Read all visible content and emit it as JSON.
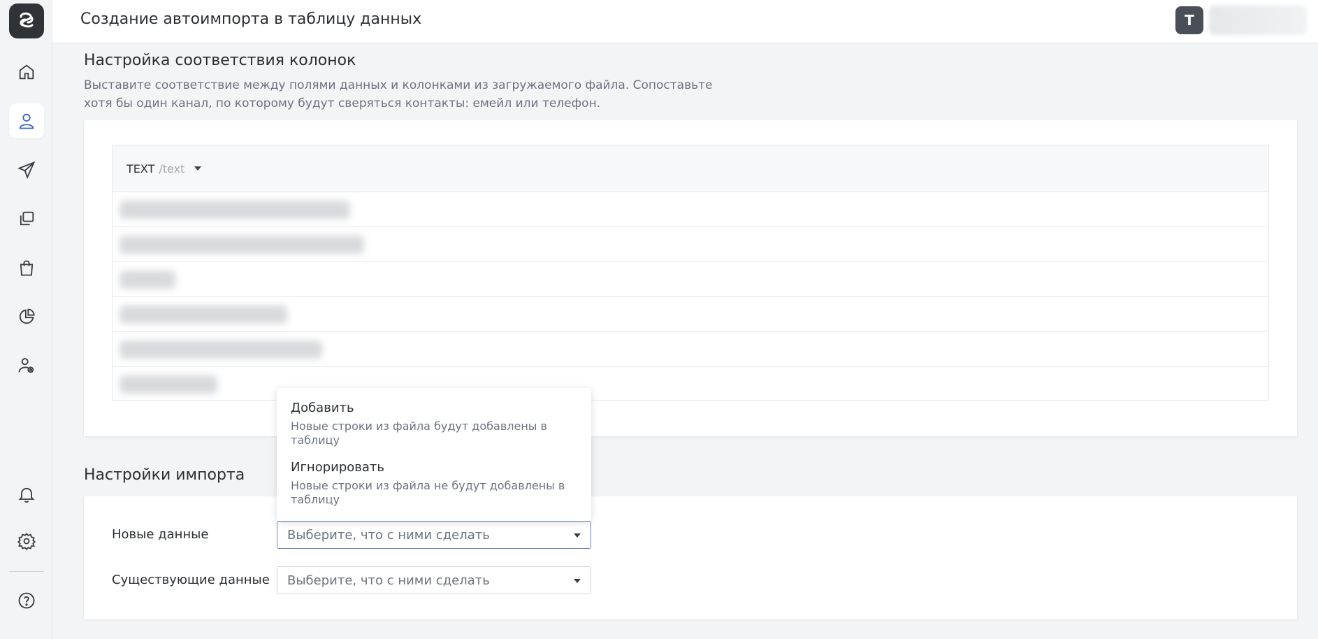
{
  "header": {
    "title": "Создание автоимпорта в таблицу данных",
    "avatar_letter": "T"
  },
  "sidebar": {
    "items": [
      {
        "name": "home-icon",
        "active": false
      },
      {
        "name": "user-icon",
        "active": true
      },
      {
        "name": "send-icon",
        "active": false
      },
      {
        "name": "copy-icon",
        "active": false
      },
      {
        "name": "shopping-bag-icon",
        "active": false
      },
      {
        "name": "pie-chart-icon",
        "active": false
      },
      {
        "name": "user-settings-icon",
        "active": false
      },
      {
        "name": "bell-icon",
        "active": false
      },
      {
        "name": "gear-icon",
        "active": false
      },
      {
        "name": "help-icon",
        "active": false
      }
    ]
  },
  "mapping": {
    "title": "Настройка соответствия колонок",
    "desc": "Выставите соответствие между полями данных и колонками из загружаемого файла. Сопоставьте хотя бы один канал, по которому будут сверяться контакты: емейл или телефон.",
    "column": {
      "type": "TEXT",
      "path": "/text"
    }
  },
  "import": {
    "title": "Настройки импорта",
    "new_label": "Новые данные",
    "existing_label": "Существующие данные",
    "placeholder": "Выберите, что с ними сделать"
  },
  "dropdown": {
    "options": [
      {
        "title": "Добавить",
        "desc": "Новые строки из файла будут добавлены в таблицу"
      },
      {
        "title": "Игнорировать",
        "desc": "Новые строки из файла не будут добавлены в таблицу"
      }
    ]
  },
  "colors": {
    "accent": "#3d63c9",
    "focus_border": "#6f82c9",
    "logo_bg": "#2f3338"
  }
}
